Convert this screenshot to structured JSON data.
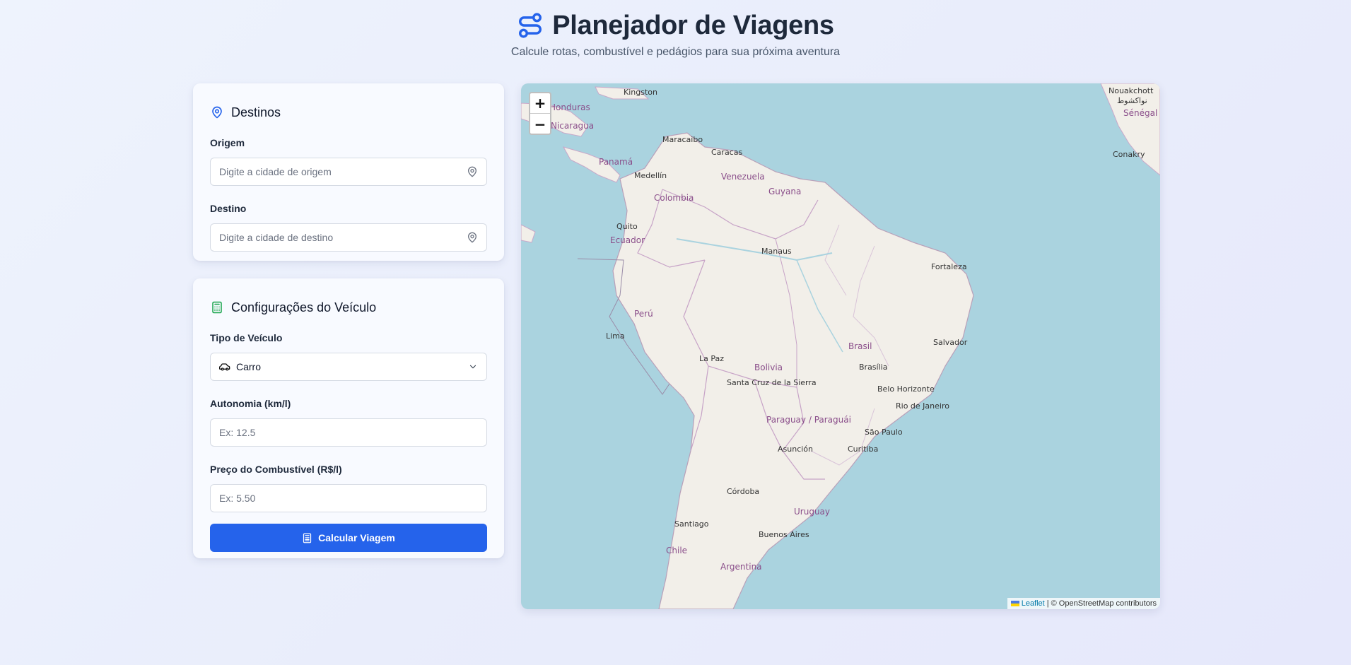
{
  "header": {
    "title": "Planejador de Viagens",
    "subtitle": "Calcule rotas, combustível e pedágios para sua próxima aventura"
  },
  "destinations": {
    "heading": "Destinos",
    "origin_label": "Origem",
    "origin_placeholder": "Digite a cidade de origem",
    "destination_label": "Destino",
    "destination_placeholder": "Digite a cidade de destino"
  },
  "vehicle": {
    "heading": "Configurações do Veículo",
    "type_label": "Tipo de Veículo",
    "type_value": "Carro",
    "autonomy_label": "Autonomia (km/l)",
    "autonomy_placeholder": "Ex: 12.5",
    "fuel_label": "Preço do Combustível (R$/l)",
    "fuel_placeholder": "Ex: 5.50",
    "calculate_label": "Calcular Viagem"
  },
  "map": {
    "zoom_in": "+",
    "zoom_out": "−",
    "attribution_link": "Leaflet",
    "attribution_text": "| © OpenStreetMap contributors",
    "countries": [
      "Venezuela",
      "Colombia",
      "Guyana",
      "Ecuador",
      "Perú",
      "Bolivia",
      "Brasil",
      "Paraguay / Paraguái",
      "Uruguay",
      "Argentina",
      "Chile",
      "Nicaragua",
      "Honduras",
      "Panamá",
      "Sénégal"
    ],
    "cities": [
      "Kingston",
      "Maracaibo",
      "Caracas",
      "Medellín",
      "Quito",
      "Manaus",
      "Fortaleza",
      "Lima",
      "La Paz",
      "Salvador",
      "Brasília",
      "Santa Cruz de la Sierra",
      "Belo Horizonte",
      "Rio de Janeiro",
      "São Paulo",
      "Curitiba",
      "Asunción",
      "Córdoba",
      "Santiago",
      "Buenos Aires",
      "Nouakchott",
      "نواكشوط",
      "Conakry"
    ]
  },
  "colors": {
    "accent": "#2563eb",
    "calculator_icon": "#16a34a",
    "water": "#aad3df",
    "land": "#f2efe9"
  }
}
